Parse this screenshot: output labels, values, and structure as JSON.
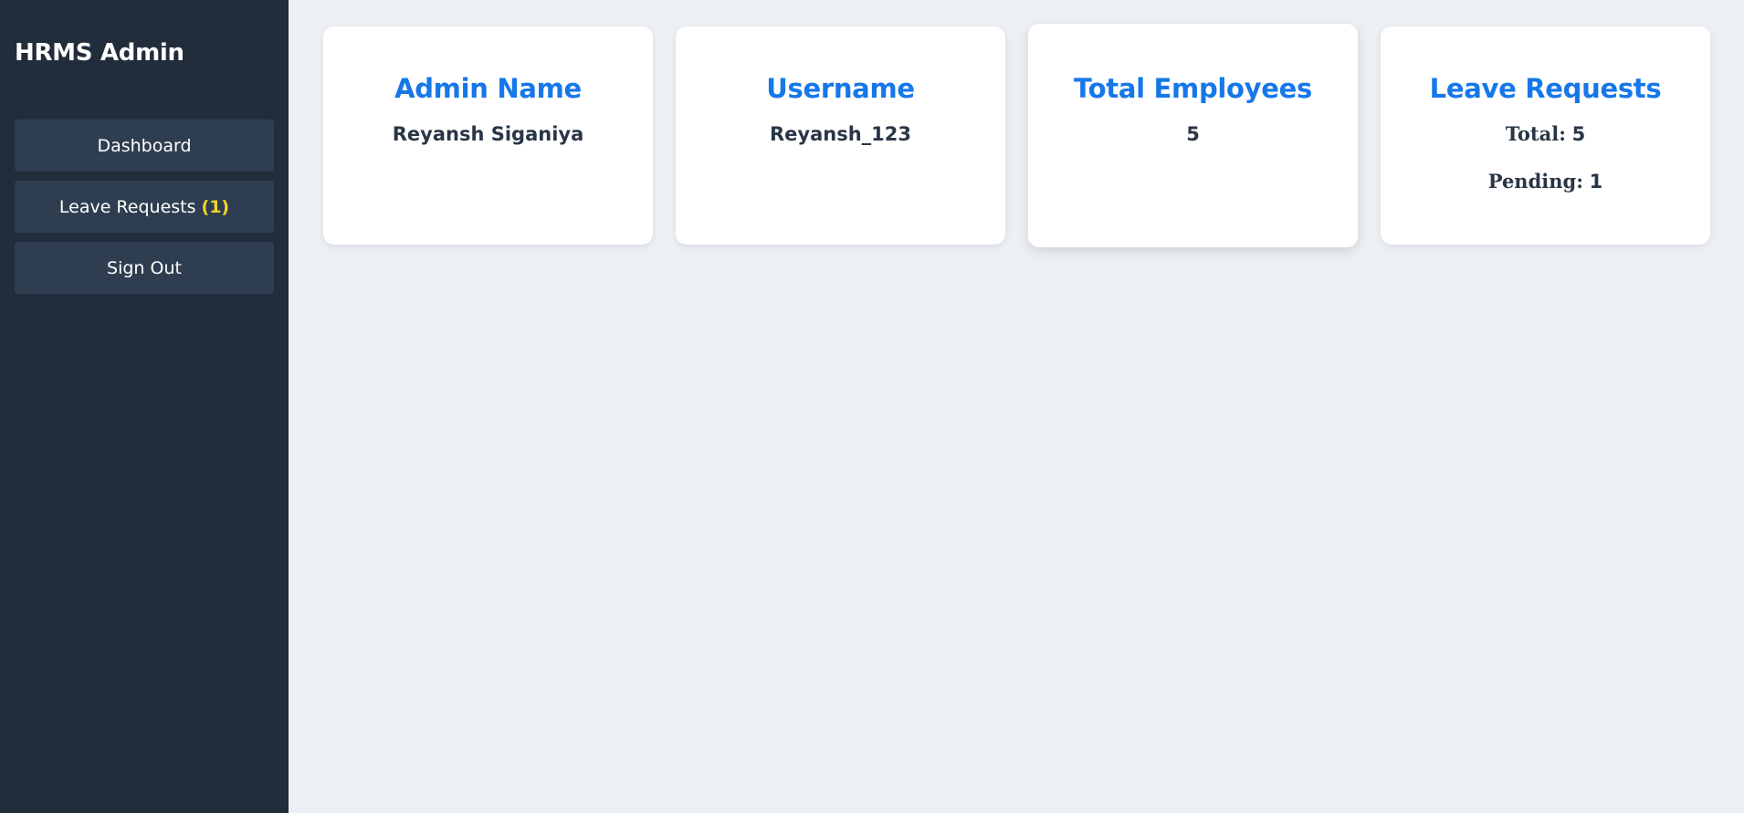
{
  "sidebar": {
    "title": "HRMS Admin",
    "items": [
      {
        "label": "Dashboard"
      },
      {
        "label": "Leave Requests",
        "badge": "(1)"
      },
      {
        "label": "Sign Out"
      }
    ]
  },
  "cards": {
    "admin_name": {
      "title": "Admin Name",
      "value": "Reyansh Siganiya"
    },
    "username": {
      "title": "Username",
      "value": "Reyansh_123"
    },
    "total_employees": {
      "title": "Total Employees",
      "value": "5"
    },
    "leave_requests": {
      "title": "Leave Requests",
      "total_label": "Total:",
      "total_value": "5",
      "pending_label": "Pending:",
      "pending_value": "1"
    }
  },
  "colors": {
    "sidebar_bg": "#212d3b",
    "nav_item_bg": "#2e3e50",
    "accent": "#1677e8",
    "badge": "#f5d328",
    "page_bg": "#eceff4"
  }
}
